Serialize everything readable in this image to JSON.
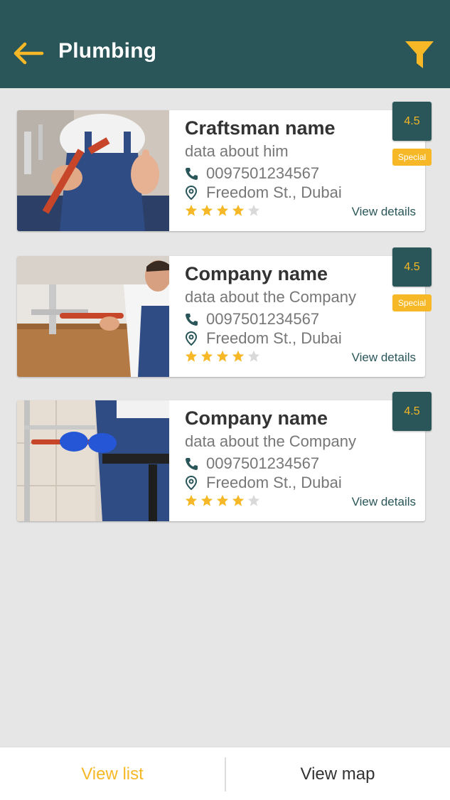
{
  "header": {
    "title": "Plumbing",
    "back_icon": "arrow-left-icon",
    "filter_icon": "filter-icon",
    "color": "#2a5659",
    "accent": "#f6b826"
  },
  "cards": [
    {
      "name": "Craftsman name",
      "description": "data about him",
      "phone": "0097501234567",
      "address": "Freedom St., Dubai",
      "rating": "4.5",
      "stars_filled": 4,
      "stars_total": 5,
      "special": "Special",
      "view_details": "View details"
    },
    {
      "name": "Company name",
      "description": "data about the Company",
      "phone": "0097501234567",
      "address": "Freedom St., Dubai",
      "rating": "4.5",
      "stars_filled": 4,
      "stars_total": 5,
      "special": "Special",
      "view_details": "View details"
    },
    {
      "name": "Company name",
      "description": "data about the Company",
      "phone": "0097501234567",
      "address": "Freedom St., Dubai",
      "rating": "4.5",
      "stars_filled": 4,
      "stars_total": 5,
      "view_details": "View details"
    }
  ],
  "bottom_bar": {
    "view_list": "View list",
    "view_map": "View map",
    "active_color": "#f6b826",
    "inactive_color": "#333333"
  }
}
